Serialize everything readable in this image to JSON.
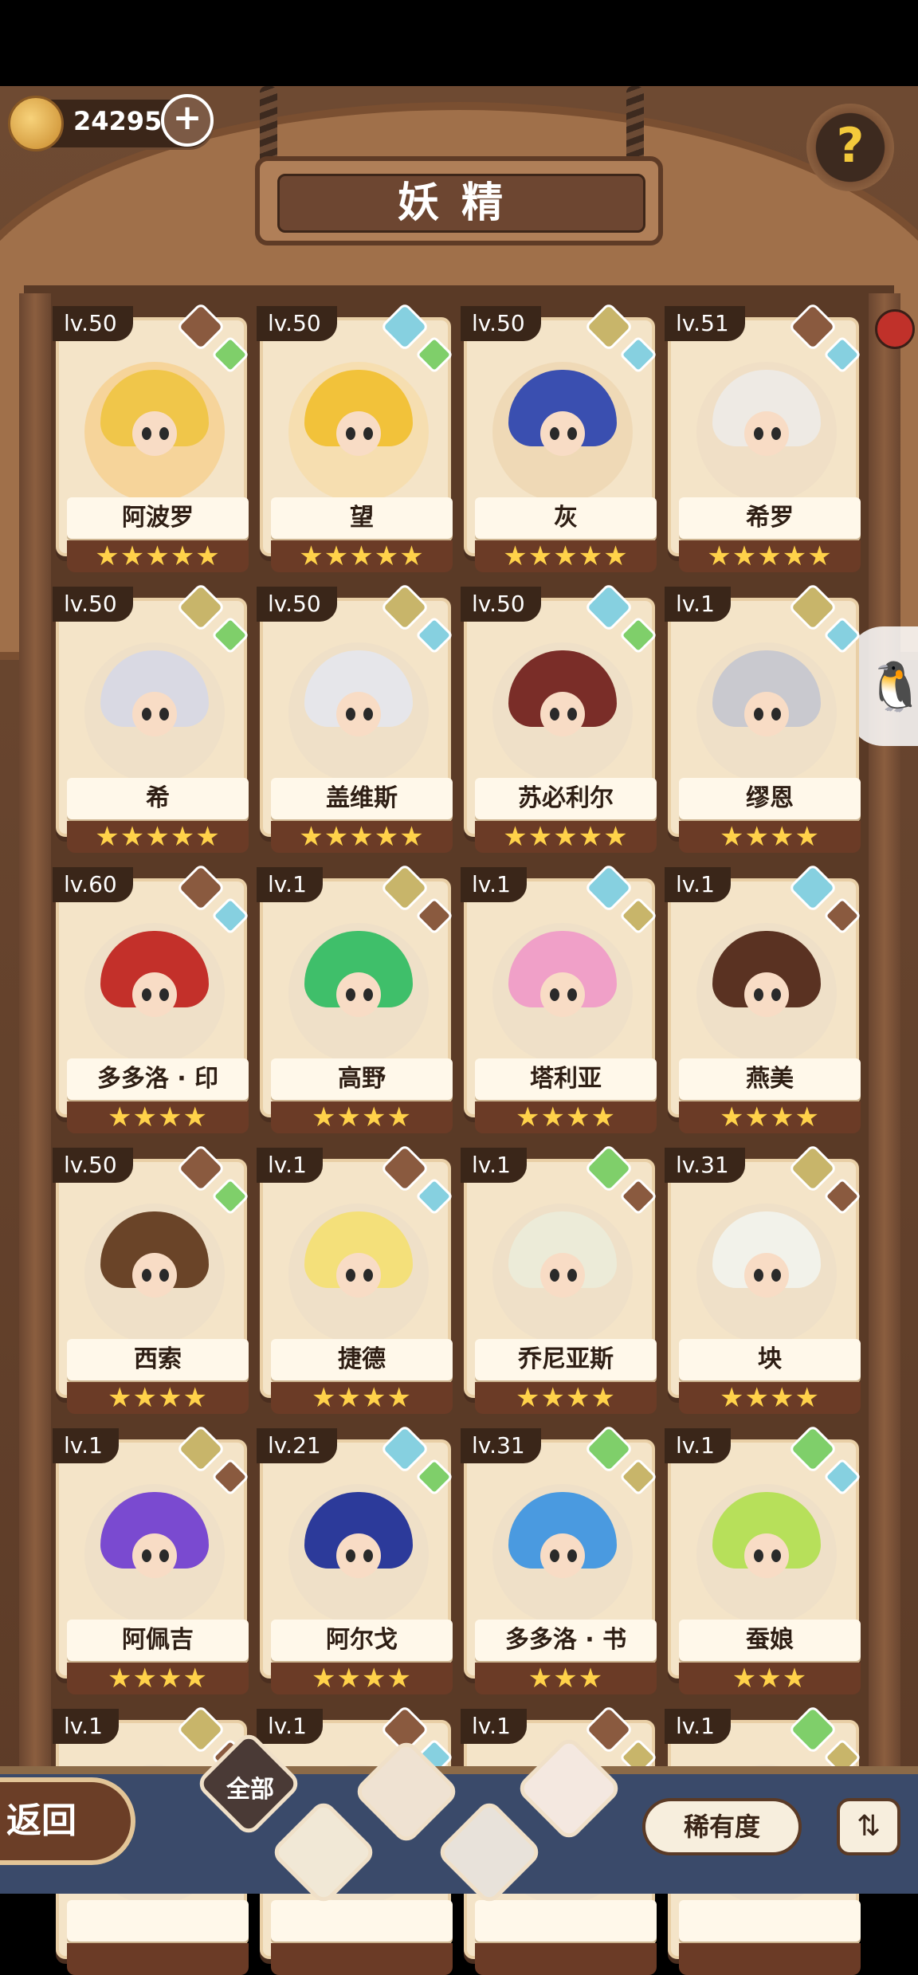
{
  "header": {
    "coins": "24295",
    "title": "妖精"
  },
  "cards": [
    {
      "level": "lv.50",
      "name": "阿波罗",
      "stars": "★★★★★",
      "hair": "#f0c64a",
      "bg": "#f6d49a",
      "gem1": "rock",
      "gem2": "plant"
    },
    {
      "level": "lv.50",
      "name": "望",
      "stars": "★★★★★",
      "hair": "#f2c23a",
      "bg": "#f6deb0",
      "gem1": "wind",
      "gem2": "plant"
    },
    {
      "level": "lv.50",
      "name": "灰",
      "stars": "★★★★★",
      "hair": "#3a4fb0",
      "bg": "#efd9b6",
      "gem1": "earth",
      "gem2": "wind"
    },
    {
      "level": "lv.51",
      "name": "希罗",
      "stars": "★★★★★",
      "hair": "#eeeae4",
      "bg": "#f0dfc6",
      "gem1": "rock",
      "gem2": "wind"
    },
    {
      "level": "lv.50",
      "name": "希",
      "stars": "★★★★★",
      "hair": "#d9d9e3",
      "bg": "#efe0c8",
      "gem1": "earth",
      "gem2": "plant"
    },
    {
      "level": "lv.50",
      "name": "盖维斯",
      "stars": "★★★★★",
      "hair": "#e6e6ea",
      "bg": "#efe0c8",
      "gem1": "earth",
      "gem2": "wind"
    },
    {
      "level": "lv.50",
      "name": "苏必利尔",
      "stars": "★★★★★",
      "hair": "#7a2d28",
      "bg": "#efe0c8",
      "gem1": "wind",
      "gem2": "plant"
    },
    {
      "level": "lv.1",
      "name": "缪恩",
      "stars": "★★★★",
      "hair": "#c9c9cf",
      "bg": "#efe0c8",
      "gem1": "earth",
      "gem2": "wind"
    },
    {
      "level": "lv.60",
      "name": "多多洛 · 印",
      "stars": "★★★★",
      "hair": "#c3302a",
      "bg": "#efe0c8",
      "gem1": "rock",
      "gem2": "wind"
    },
    {
      "level": "lv.1",
      "name": "高野",
      "stars": "★★★★",
      "hair": "#3fbf6a",
      "bg": "#efe0c8",
      "gem1": "earth",
      "gem2": "rock"
    },
    {
      "level": "lv.1",
      "name": "塔利亚",
      "stars": "★★★★",
      "hair": "#f0a0c8",
      "bg": "#efe0c8",
      "gem1": "wind",
      "gem2": "earth"
    },
    {
      "level": "lv.1",
      "name": "燕美",
      "stars": "★★★★",
      "hair": "#5a3222",
      "bg": "#efe0c8",
      "gem1": "wind",
      "gem2": "rock"
    },
    {
      "level": "lv.50",
      "name": "西索",
      "stars": "★★★★",
      "hair": "#6a4428",
      "bg": "#efe0c8",
      "gem1": "rock",
      "gem2": "plant"
    },
    {
      "level": "lv.1",
      "name": "捷德",
      "stars": "★★★★",
      "hair": "#f4e07a",
      "bg": "#efe0c8",
      "gem1": "rock",
      "gem2": "wind"
    },
    {
      "level": "lv.1",
      "name": "乔尼亚斯",
      "stars": "★★★★",
      "hair": "#ecebd8",
      "bg": "#efe0c8",
      "gem1": "plant",
      "gem2": "rock"
    },
    {
      "level": "lv.31",
      "name": "坱",
      "stars": "★★★★",
      "hair": "#f2f2ea",
      "bg": "#efe0c8",
      "gem1": "earth",
      "gem2": "rock"
    },
    {
      "level": "lv.1",
      "name": "阿佩吉",
      "stars": "★★★★",
      "hair": "#7a4ad0",
      "bg": "#efe0c8",
      "gem1": "earth",
      "gem2": "rock"
    },
    {
      "level": "lv.21",
      "name": "阿尔戈",
      "stars": "★★★★",
      "hair": "#2c3a9a",
      "bg": "#efe0c8",
      "gem1": "wind",
      "gem2": "plant"
    },
    {
      "level": "lv.31",
      "name": "多多洛 · 书",
      "stars": "★★★",
      "hair": "#4a9ae0",
      "bg": "#efe0c8",
      "gem1": "plant",
      "gem2": "earth"
    },
    {
      "level": "lv.1",
      "name": "蚕娘",
      "stars": "★★★",
      "hair": "#b7e05a",
      "bg": "#efe0c8",
      "gem1": "plant",
      "gem2": "wind"
    },
    {
      "level": "lv.1",
      "name": "",
      "stars": "",
      "hair": "#d0b070",
      "bg": "#efe0c8",
      "gem1": "earth",
      "gem2": "rock"
    },
    {
      "level": "lv.1",
      "name": "",
      "stars": "",
      "hair": "#9ad0b0",
      "bg": "#efe0c8",
      "gem1": "rock",
      "gem2": "wind"
    },
    {
      "level": "lv.1",
      "name": "",
      "stars": "",
      "hair": "#d08060",
      "bg": "#efe0c8",
      "gem1": "rock",
      "gem2": "earth"
    },
    {
      "level": "lv.1",
      "name": "",
      "stars": "",
      "hair": "#f0d060",
      "bg": "#efe0c8",
      "gem1": "plant",
      "gem2": "earth"
    }
  ],
  "gem_colors": {
    "rock": "#8a5a3f",
    "wind": "#86d0e0",
    "earth": "#c8b56a",
    "plant": "#7fcf6a"
  },
  "footer": {
    "back_label": "返回",
    "filter_all": "全部",
    "sort_label": "稀有度",
    "order_icon": "sort-order-icon"
  }
}
